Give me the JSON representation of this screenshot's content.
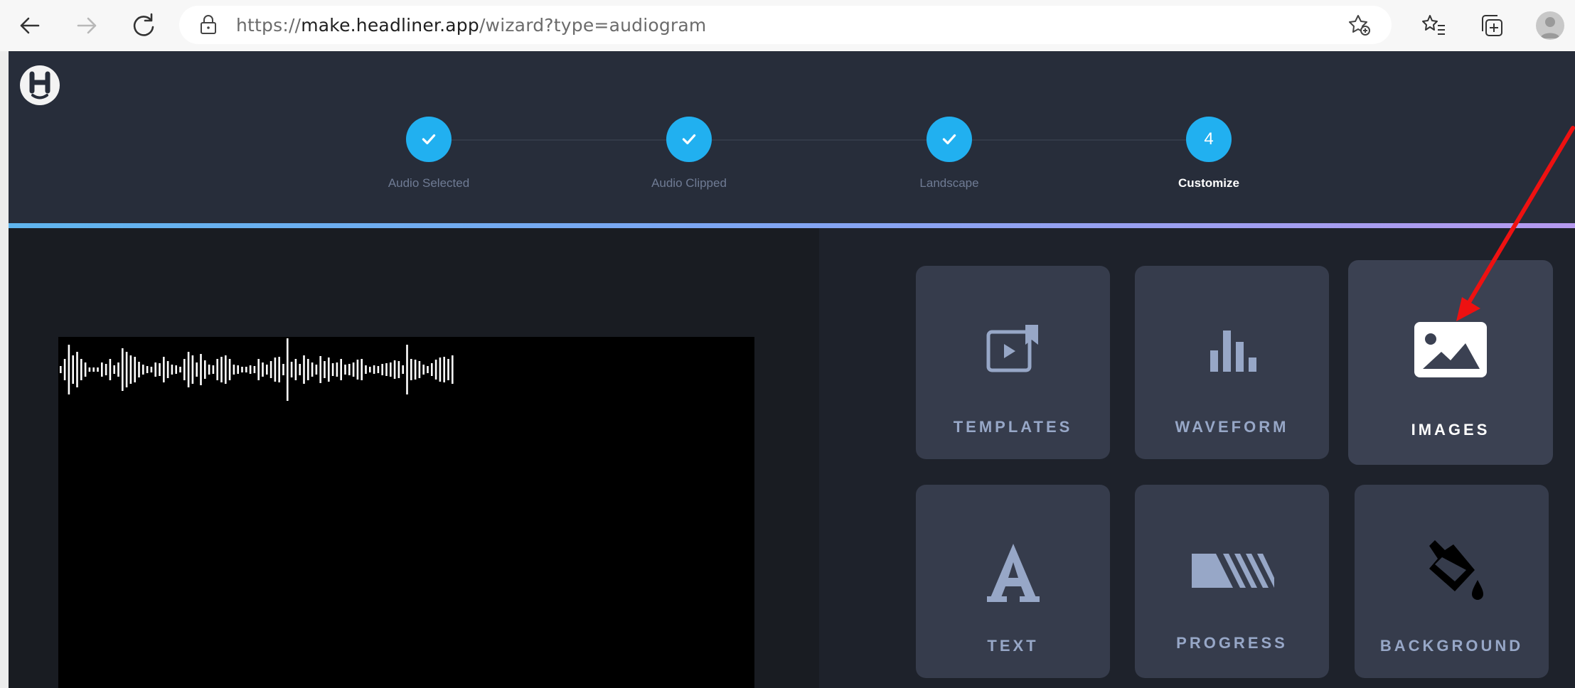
{
  "browser": {
    "url_scheme": "https://",
    "url_host": "make.headliner.app",
    "url_path": "/wizard?type=audiogram"
  },
  "stepper": {
    "steps": [
      {
        "label": "Audio Selected",
        "state": "done"
      },
      {
        "label": "Audio Clipped",
        "state": "done"
      },
      {
        "label": "Landscape",
        "state": "done"
      },
      {
        "label": "Customize",
        "state": "active",
        "number": "4"
      }
    ]
  },
  "toolbox": {
    "tiles": [
      {
        "label": "TEMPLATES",
        "icon": "templates-icon"
      },
      {
        "label": "WAVEFORM",
        "icon": "waveform-icon"
      },
      {
        "label": "IMAGES",
        "icon": "image-icon"
      },
      {
        "label": "TEXT",
        "icon": "text-icon"
      },
      {
        "label": "PROGRESS",
        "icon": "progress-icon"
      },
      {
        "label": "BACKGROUND",
        "icon": "paint-bucket-icon"
      }
    ]
  },
  "colors": {
    "header_bg": "#272d3a",
    "step_accent": "#21b0f0",
    "tile_bg": "#363c4c",
    "tile_label": "#97a7c7",
    "annotation_arrow": "#ee1111"
  }
}
